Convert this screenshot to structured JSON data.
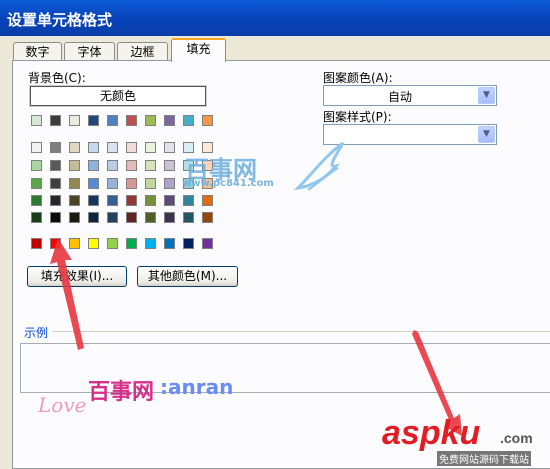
{
  "window": {
    "title": "设置单元格格式"
  },
  "tabs": [
    {
      "label": "数字"
    },
    {
      "label": "字体"
    },
    {
      "label": "边框"
    },
    {
      "label": "填充",
      "active": true
    }
  ],
  "background": {
    "label": "背景色(C):",
    "no_color_button": "无颜色",
    "theme_row": [
      "#d8e8d6",
      "#3c3c3c",
      "#eeece1",
      "#1f497d",
      "#4f81bd",
      "#c0504d",
      "#9bbb59",
      "#8064a2",
      "#4bacc6",
      "#f79646"
    ],
    "tint_rows": [
      [
        "#f2f2f2",
        "#7f7f7f",
        "#ddd9c3",
        "#c6d9f0",
        "#dbe5f1",
        "#f2dcdb",
        "#ebf1dd",
        "#e5e0ec",
        "#dbeef3",
        "#fdeada"
      ],
      [
        "#a9d5a0",
        "#595959",
        "#c4bd97",
        "#8db3e2",
        "#b8cce4",
        "#e5b9b7",
        "#d7e3bc",
        "#ccc1d9",
        "#b7dde8",
        "#fbd5b5"
      ],
      [
        "#5aa84a",
        "#3f3f3f",
        "#938953",
        "#548dd4",
        "#95b3d7",
        "#d99694",
        "#c3d69b",
        "#b2a2c7",
        "#92cddc",
        "#fac08f"
      ],
      [
        "#2d7a30",
        "#262626",
        "#494429",
        "#17365d",
        "#366092",
        "#953734",
        "#76923c",
        "#5f497a",
        "#31859b",
        "#e36c09"
      ],
      [
        "#163f18",
        "#0c0c0c",
        "#1d1b10",
        "#0f243e",
        "#244061",
        "#632423",
        "#4f6128",
        "#3f3151",
        "#205867",
        "#974806"
      ]
    ],
    "standard_row": [
      "#c00000",
      "#ff0000",
      "#ffc000",
      "#ffff00",
      "#92d050",
      "#00b050",
      "#00b0f0",
      "#0070c0",
      "#002060",
      "#7030a0"
    ]
  },
  "buttons": {
    "fill_effects": "填充效果(I)...",
    "more_colors": "其他颜色(M)..."
  },
  "pattern": {
    "color_label": "图案颜色(A):",
    "color_value": "自动",
    "style_label": "图案样式(P):",
    "style_value": ""
  },
  "sample": {
    "label": "示例"
  },
  "watermarks": {
    "top_brand": "百事网",
    "top_url": "www.pc841.com",
    "bottom_cn": "百事网",
    "bottom_en": ":anran",
    "bottom_script": "Love",
    "corner_brand": "aspku",
    "corner_tld": ".com",
    "corner_sub": "免费网站源码下载站"
  },
  "colors": {
    "accent_tab": "#f5a623",
    "arrow_red": "#e8353f",
    "title_bar": "#0842b8"
  }
}
